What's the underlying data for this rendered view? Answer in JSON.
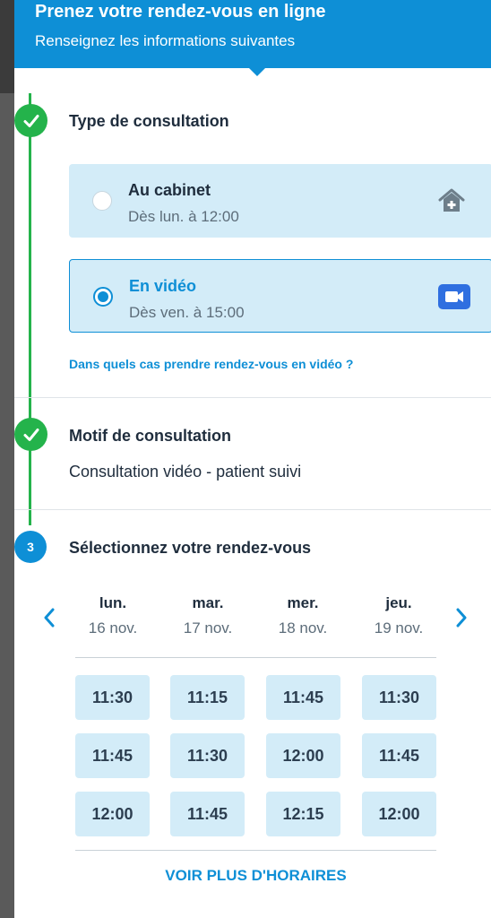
{
  "header": {
    "title": "Prenez votre rendez-vous en ligne",
    "subtitle": "Renseignez les informations suivantes"
  },
  "steps": {
    "consultation_type": {
      "title": "Type de consultation",
      "options": [
        {
          "label": "Au cabinet",
          "sub": "Dès lun. à 12:00",
          "selected": false,
          "icon": "house-medical-icon"
        },
        {
          "label": "En vidéo",
          "sub": "Dès ven. à 15:00",
          "selected": true,
          "icon": "video-camera-icon"
        }
      ],
      "link": "Dans quels cas prendre rendez-vous en vidéo ?"
    },
    "motif": {
      "title": "Motif de consultation",
      "value": "Consultation vidéo - patient suivi"
    },
    "select": {
      "number": "3",
      "title": "Sélectionnez votre rendez-vous"
    }
  },
  "calendar": {
    "days": [
      {
        "name": "lun.",
        "date": "16 nov.",
        "slots": [
          "11:30",
          "11:45",
          "12:00"
        ]
      },
      {
        "name": "mar.",
        "date": "17 nov.",
        "slots": [
          "11:15",
          "11:30",
          "11:45"
        ]
      },
      {
        "name": "mer.",
        "date": "18 nov.",
        "slots": [
          "11:45",
          "12:00",
          "12:15"
        ]
      },
      {
        "name": "jeu.",
        "date": "19 nov.",
        "slots": [
          "11:30",
          "11:45",
          "12:00"
        ]
      }
    ],
    "more_label": "VOIR PLUS D'HORAIRES"
  },
  "colors": {
    "primary": "#0e8fd6",
    "success": "#24b34b",
    "option_bg": "#d3ecf8",
    "text": "#1f2d3d"
  }
}
